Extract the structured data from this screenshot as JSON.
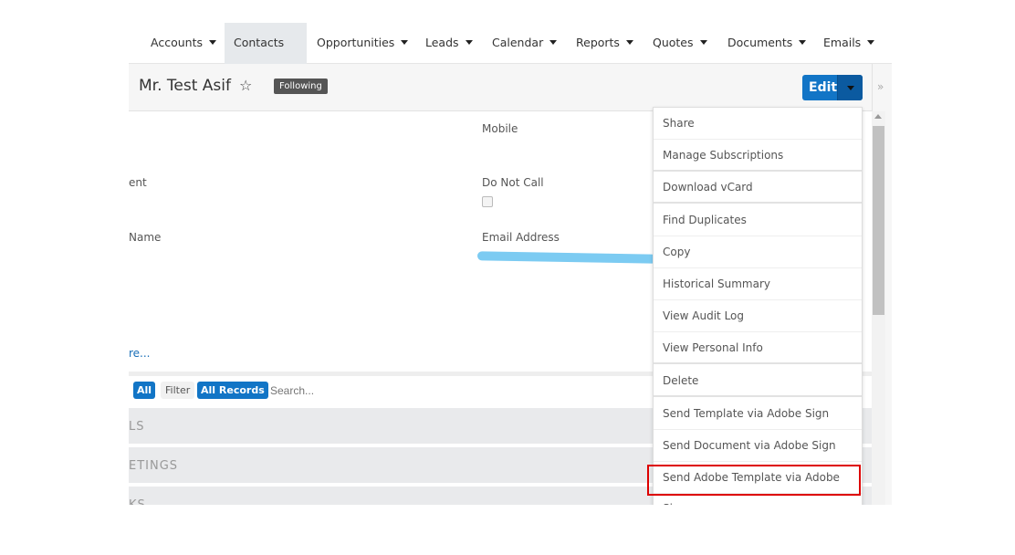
{
  "nav": {
    "items": [
      {
        "label": "Accounts"
      },
      {
        "label": "Contacts",
        "active": true
      },
      {
        "label": "Opportunities"
      },
      {
        "label": "Leads"
      },
      {
        "label": "Calendar"
      },
      {
        "label": "Reports"
      },
      {
        "label": "Quotes"
      },
      {
        "label": "Documents"
      },
      {
        "label": "Emails"
      }
    ]
  },
  "header": {
    "title": "Mr. Test Asif",
    "star_icon": "star-outline-icon",
    "badge": "Following",
    "edit_label": "Edit",
    "expand_icon": "double-chevron-right-icon"
  },
  "fields": {
    "mobile": "Mobile",
    "do_not_call": "Do Not Call",
    "email": "Email Address",
    "left1": "ent",
    "left2": "Name",
    "more": "re..."
  },
  "filter": {
    "all": "All",
    "filter": "Filter",
    "all_records": "All Records",
    "search_placeholder": "Search..."
  },
  "panels": [
    "LS",
    "ETINGS",
    "KS"
  ],
  "menu": {
    "items": [
      "Share",
      "Manage Subscriptions",
      "Download vCard",
      "Find Duplicates",
      "Copy",
      "Historical Summary",
      "View Audit Log",
      "View Personal Info",
      "Delete",
      "Send Template via Adobe Sign",
      "Send Document via Adobe Sign",
      "Send Adobe Template via Adobe Sign"
    ],
    "highlighted": "Send Adobe Template via Adobe Sign"
  },
  "colors": {
    "accent": "#1275c6",
    "highlight": "#dd0000",
    "redaction": "#7ccbf2"
  }
}
